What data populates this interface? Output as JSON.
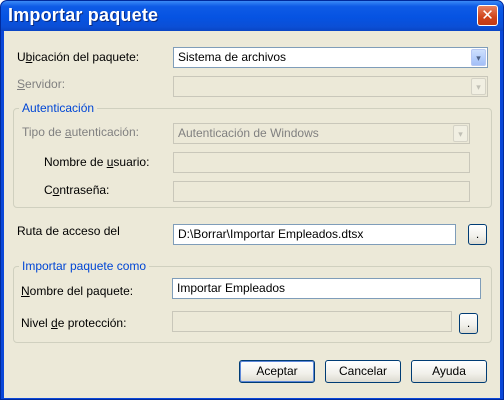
{
  "window": {
    "title": "Importar paquete",
    "close_symbol": "✕"
  },
  "location": {
    "label_pre": "U",
    "label_ul": "b",
    "label_post": "icación del paquete:",
    "value": "Sistema de archivos"
  },
  "server": {
    "label_ul": "S",
    "label_post": "ervidor:",
    "value": ""
  },
  "auth": {
    "group_title": "Autenticación",
    "type": {
      "label_pre": "Tipo de ",
      "label_ul": "a",
      "label_post": "utenticación:",
      "value": "Autenticación de Windows"
    },
    "user": {
      "label_pre": "Nombre de ",
      "label_ul": "u",
      "label_post": "suario:",
      "value": ""
    },
    "password": {
      "label_pre": "C",
      "label_ul": "o",
      "label_post": "ntraseña:",
      "value": ""
    }
  },
  "path": {
    "label": "Ruta de acceso del",
    "value": "D:\\Borrar\\Importar Empleados.dtsx",
    "browse_label": "."
  },
  "import_as": {
    "group_title": "Importar paquete como",
    "name": {
      "label_ul": "N",
      "label_post": "ombre del paquete:",
      "value": "Importar Empleados"
    },
    "protection": {
      "label_pre": "Nivel ",
      "label_ul": "d",
      "label_post": "e protección:",
      "value": "",
      "browse_label": "."
    }
  },
  "buttons": {
    "ok": "Aceptar",
    "cancel": "Cancelar",
    "help": "Ayuda"
  },
  "icons": {
    "combo_arrow": "▾"
  },
  "colors": {
    "title_bar": "#0653e2",
    "dialog_bg": "#ece9d8",
    "group_title": "#0046d5"
  }
}
